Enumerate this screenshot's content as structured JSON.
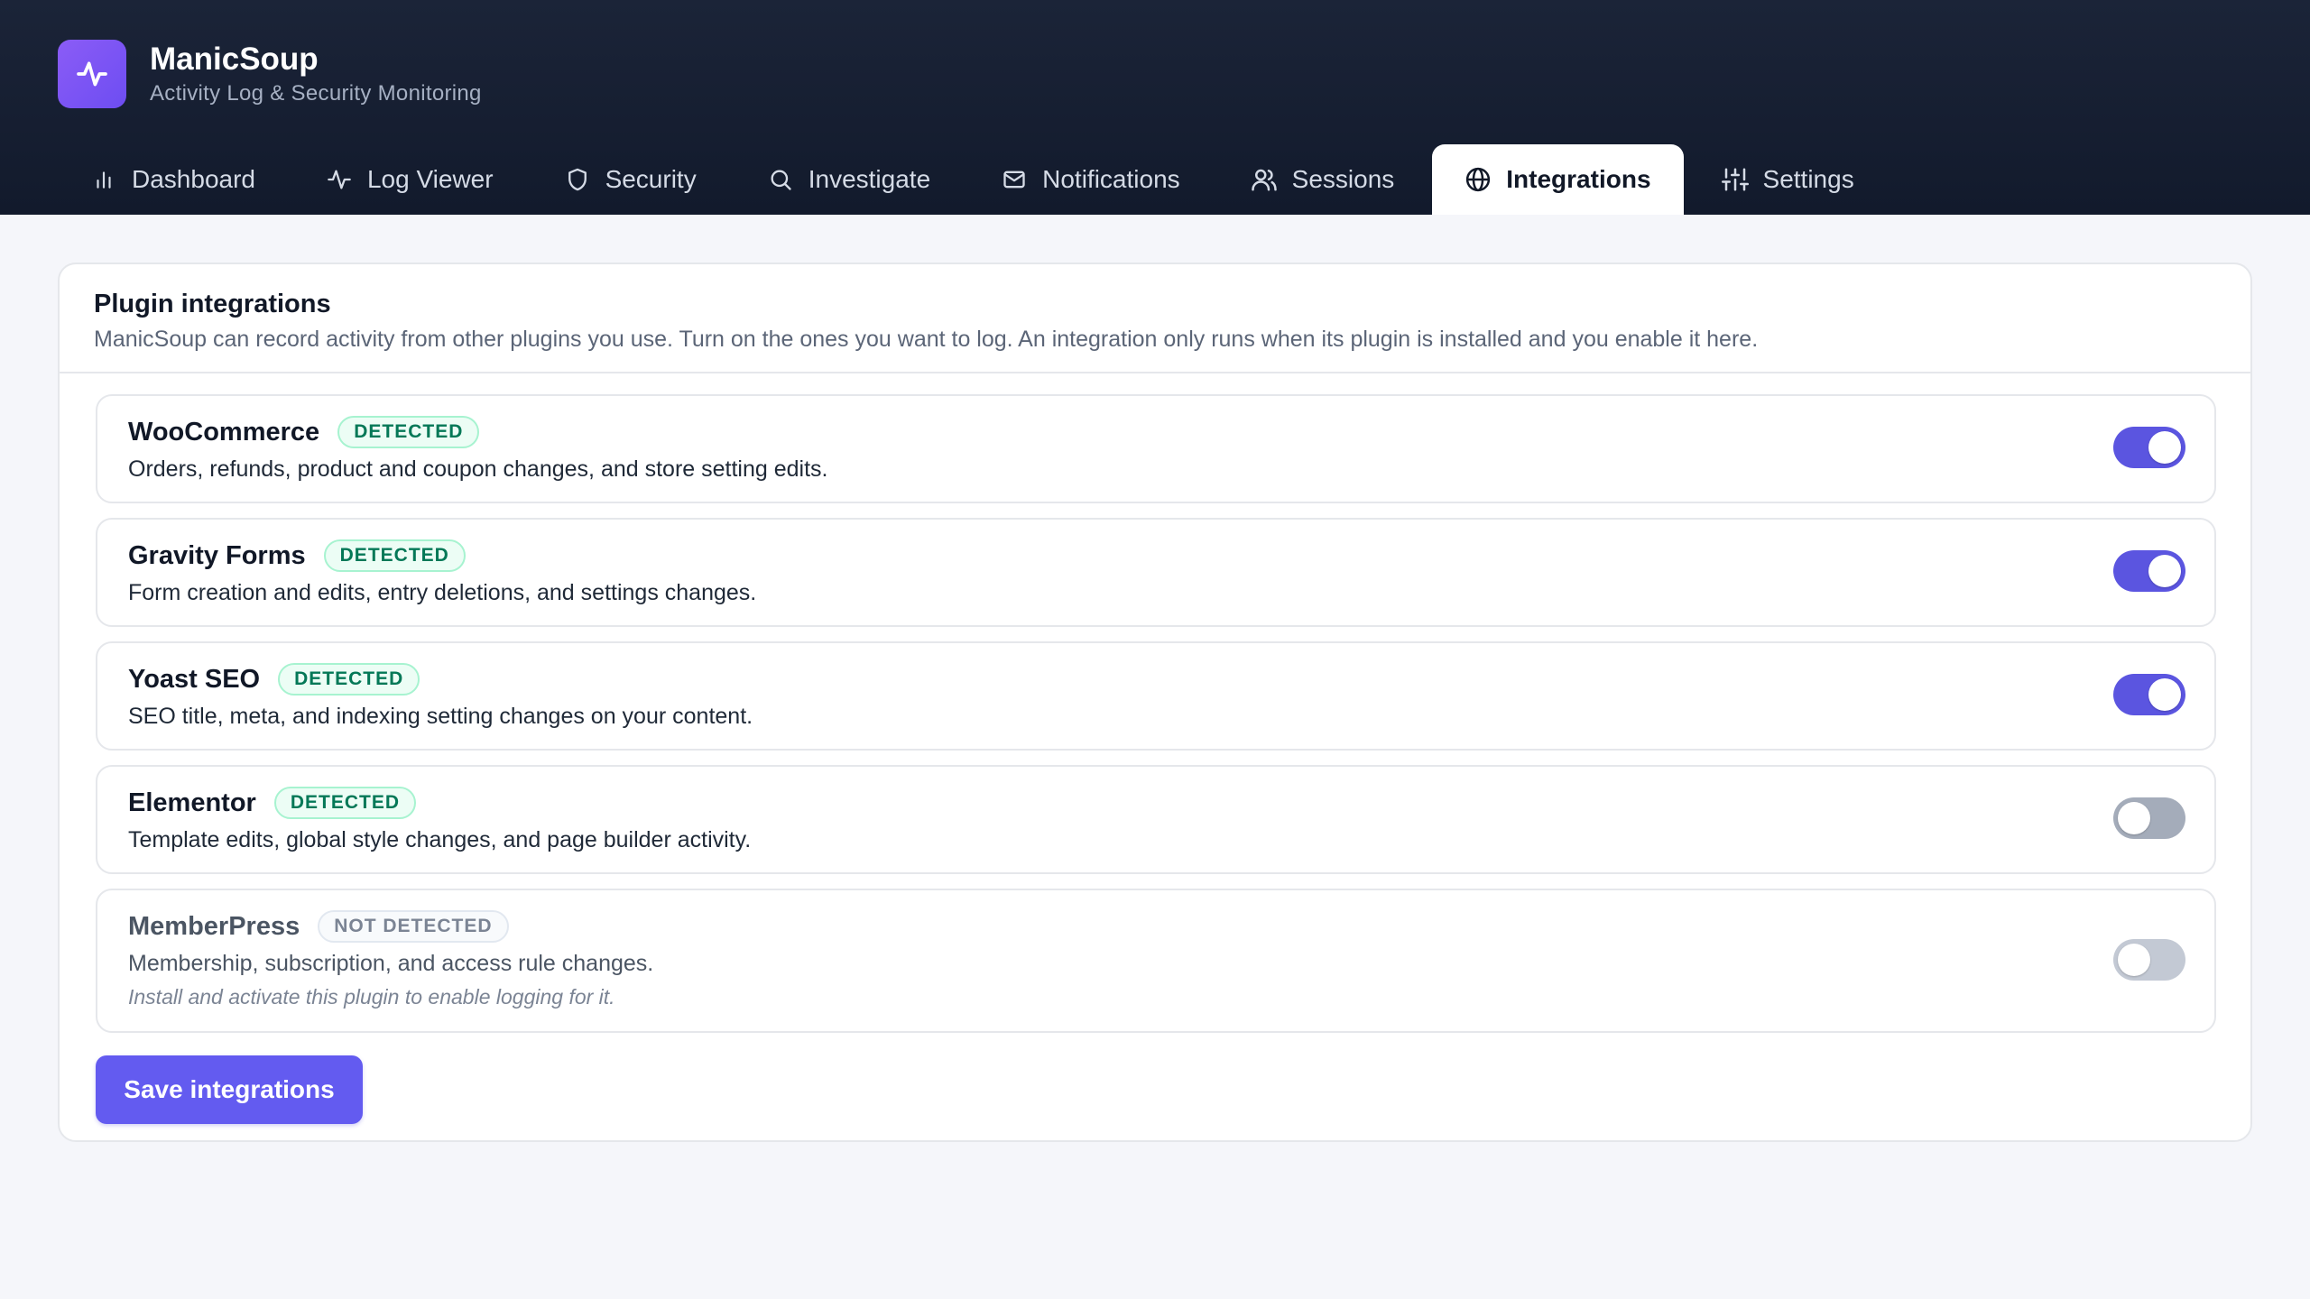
{
  "app": {
    "name": "ManicSoup",
    "tagline": "Activity Log & Security Monitoring",
    "logo_icon": "activity-pulse-icon",
    "brand_color": "#7c5cf4"
  },
  "tabs": [
    {
      "label": "Dashboard",
      "icon": "bar-chart-icon",
      "active": false
    },
    {
      "label": "Log Viewer",
      "icon": "activity-icon",
      "active": false
    },
    {
      "label": "Security",
      "icon": "shield-icon",
      "active": false
    },
    {
      "label": "Investigate",
      "icon": "search-icon",
      "active": false
    },
    {
      "label": "Notifications",
      "icon": "mail-icon",
      "active": false
    },
    {
      "label": "Sessions",
      "icon": "users-icon",
      "active": false
    },
    {
      "label": "Integrations",
      "icon": "globe-icon",
      "active": true
    },
    {
      "label": "Settings",
      "icon": "sliders-icon",
      "active": false
    }
  ],
  "panel": {
    "title": "Plugin integrations",
    "description": "ManicSoup can record activity from other plugins you use. Turn on the ones you want to log. An integration only runs when its plugin is installed and you enable it here."
  },
  "integrations": [
    {
      "name": "WooCommerce",
      "status": "DETECTED",
      "description": "Orders, refunds, product and coupon changes, and store setting edits.",
      "enabled": true
    },
    {
      "name": "Gravity Forms",
      "status": "DETECTED",
      "description": "Form creation and edits, entry deletions, and settings changes.",
      "enabled": true
    },
    {
      "name": "Yoast SEO",
      "status": "DETECTED",
      "description": "SEO title, meta, and indexing setting changes on your content.",
      "enabled": true
    },
    {
      "name": "Elementor",
      "status": "DETECTED",
      "description": "Template edits, global style changes, and page builder activity.",
      "enabled": false
    },
    {
      "name": "MemberPress",
      "status": "NOT DETECTED",
      "description": "Membership, subscription, and access rule changes.",
      "note": "Install and activate this plugin to enable logging for it.",
      "enabled": false
    }
  ],
  "save_label": "Save integrations",
  "colors": {
    "header_bg": "#161f33",
    "accent": "#635bf0",
    "toggle_on": "#5b55e0",
    "toggle_off": "#a4acba",
    "detected_text": "#047857"
  }
}
